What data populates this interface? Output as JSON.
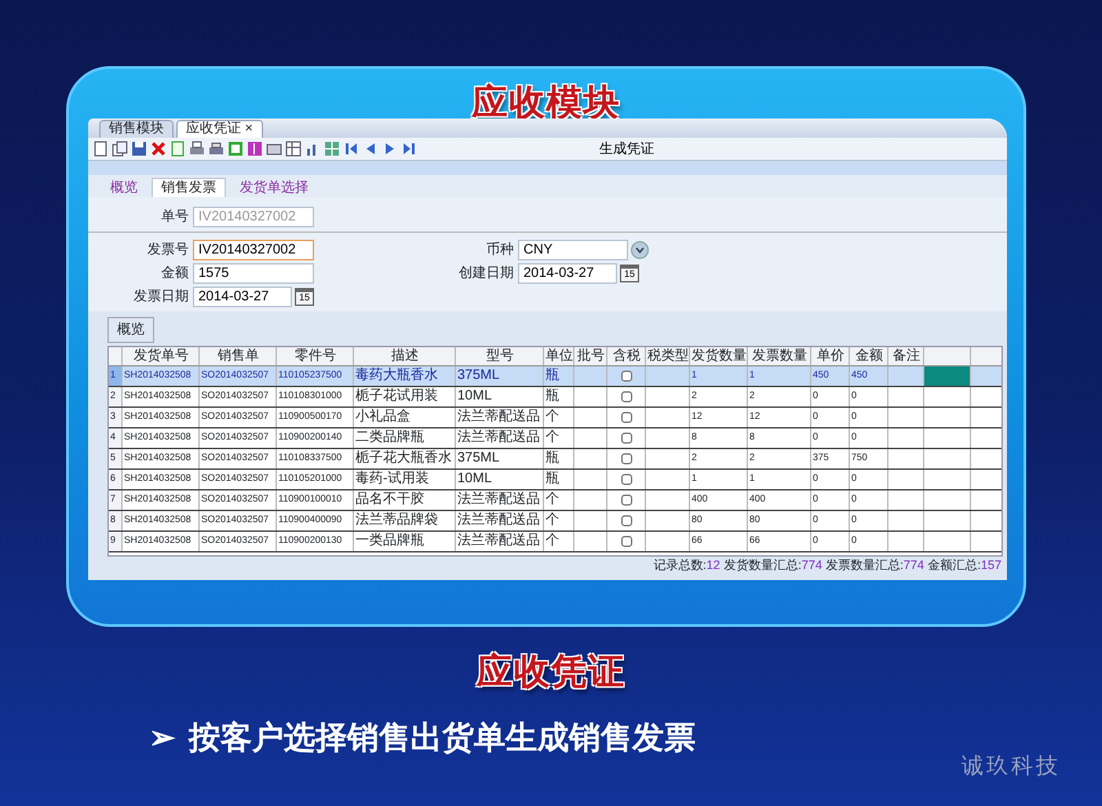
{
  "slide_title": "应收模块",
  "window": {
    "tabs": [
      {
        "label": "销售模块",
        "selected": false
      },
      {
        "label": "应收凭证",
        "selected": true,
        "close": "×"
      }
    ],
    "toolbar": {
      "action": "生成凭证"
    },
    "subtabs": [
      {
        "label": "概览",
        "selected": false
      },
      {
        "label": "销售发票",
        "selected": true
      },
      {
        "label": "发货单选择",
        "selected": false
      }
    ],
    "doc_no": {
      "label": "单号",
      "value": "IV20140327002",
      "disabled": true
    },
    "fields_left": [
      {
        "kind": "text",
        "label": "发票号",
        "value": "IV20140327002",
        "focused": true
      },
      {
        "kind": "text",
        "label": "金额",
        "value": "1575",
        "focused": false
      },
      {
        "kind": "date",
        "label": "发票日期",
        "value": "2014-03-27",
        "picker": "15",
        "focused": false
      }
    ],
    "fields_right": [
      {
        "kind": "select",
        "label": "币种",
        "value": "CNY",
        "focused": false
      },
      {
        "kind": "date",
        "label": "创建日期",
        "value": "2014-03-27",
        "picker": "15",
        "focused": false
      }
    ],
    "grid": {
      "tab": "概览",
      "columns": [
        "发货单号",
        "销售单",
        "零件号",
        "描述",
        "型号",
        "单位",
        "批号",
        "含税",
        "税类型",
        "发货数量",
        "发票数量",
        "单价",
        "金额",
        "备注"
      ],
      "rows": [
        {
          "no": "1",
          "ship_no": "SH2014032508",
          "so": "SO2014032507",
          "part": "110105237500",
          "desc": "毒药大瓶香水",
          "model": "375ML",
          "unit": "瓶",
          "tax_included": false,
          "ship_qty": "1",
          "inv_qty": "1",
          "price": "450",
          "amount": "450",
          "selected": true
        },
        {
          "no": "2",
          "ship_no": "SH2014032508",
          "so": "SO2014032507",
          "part": "110108301000",
          "desc": "栀子花试用装",
          "model": "10ML",
          "unit": "瓶",
          "tax_included": false,
          "ship_qty": "2",
          "inv_qty": "2",
          "price": "0",
          "amount": "0",
          "selected": false
        },
        {
          "no": "3",
          "ship_no": "SH2014032508",
          "so": "SO2014032507",
          "part": "110900500170",
          "desc": "小礼品盒",
          "model": "法兰蒂配送品",
          "unit": "个",
          "tax_included": false,
          "ship_qty": "12",
          "inv_qty": "12",
          "price": "0",
          "amount": "0",
          "selected": false
        },
        {
          "no": "4",
          "ship_no": "SH2014032508",
          "so": "SO2014032507",
          "part": "110900200140",
          "desc": "二类品牌瓶",
          "model": "法兰蒂配送品",
          "unit": "个",
          "tax_included": false,
          "ship_qty": "8",
          "inv_qty": "8",
          "price": "0",
          "amount": "0",
          "selected": false
        },
        {
          "no": "5",
          "ship_no": "SH2014032508",
          "so": "SO2014032507",
          "part": "110108337500",
          "desc": "栀子花大瓶香水",
          "model": "375ML",
          "unit": "瓶",
          "tax_included": false,
          "ship_qty": "2",
          "inv_qty": "2",
          "price": "375",
          "amount": "750",
          "selected": false
        },
        {
          "no": "6",
          "ship_no": "SH2014032508",
          "so": "SO2014032507",
          "part": "110105201000",
          "desc": "毒药-试用装",
          "model": "10ML",
          "unit": "瓶",
          "tax_included": false,
          "ship_qty": "1",
          "inv_qty": "1",
          "price": "0",
          "amount": "0",
          "selected": false
        },
        {
          "no": "7",
          "ship_no": "SH2014032508",
          "so": "SO2014032507",
          "part": "110900100010",
          "desc": "品名不干胶",
          "model": "法兰蒂配送品",
          "unit": "个",
          "tax_included": false,
          "ship_qty": "400",
          "inv_qty": "400",
          "price": "0",
          "amount": "0",
          "selected": false
        },
        {
          "no": "8",
          "ship_no": "SH2014032508",
          "so": "SO2014032507",
          "part": "110900400090",
          "desc": "法兰蒂品牌袋",
          "model": "法兰蒂配送品",
          "unit": "个",
          "tax_included": false,
          "ship_qty": "80",
          "inv_qty": "80",
          "price": "0",
          "amount": "0",
          "selected": false
        },
        {
          "no": "9",
          "ship_no": "SH2014032508",
          "so": "SO2014032507",
          "part": "110900200130",
          "desc": "一类品牌瓶",
          "model": "法兰蒂配送品",
          "unit": "个",
          "tax_included": false,
          "ship_qty": "66",
          "inv_qty": "66",
          "price": "0",
          "amount": "0",
          "selected": false
        }
      ],
      "summary": [
        {
          "label": "记录总数:",
          "value": "12"
        },
        {
          "label": "发货数量汇总:",
          "value": "774"
        },
        {
          "label": "发票数量汇总:",
          "value": "774"
        },
        {
          "label": "金额汇总:",
          "value": "157"
        }
      ]
    }
  },
  "caption": "应收凭证",
  "bullet": {
    "marker": "➢",
    "text": "按客户选择销售出货单生成销售发票"
  },
  "brand": "诚玖科技"
}
